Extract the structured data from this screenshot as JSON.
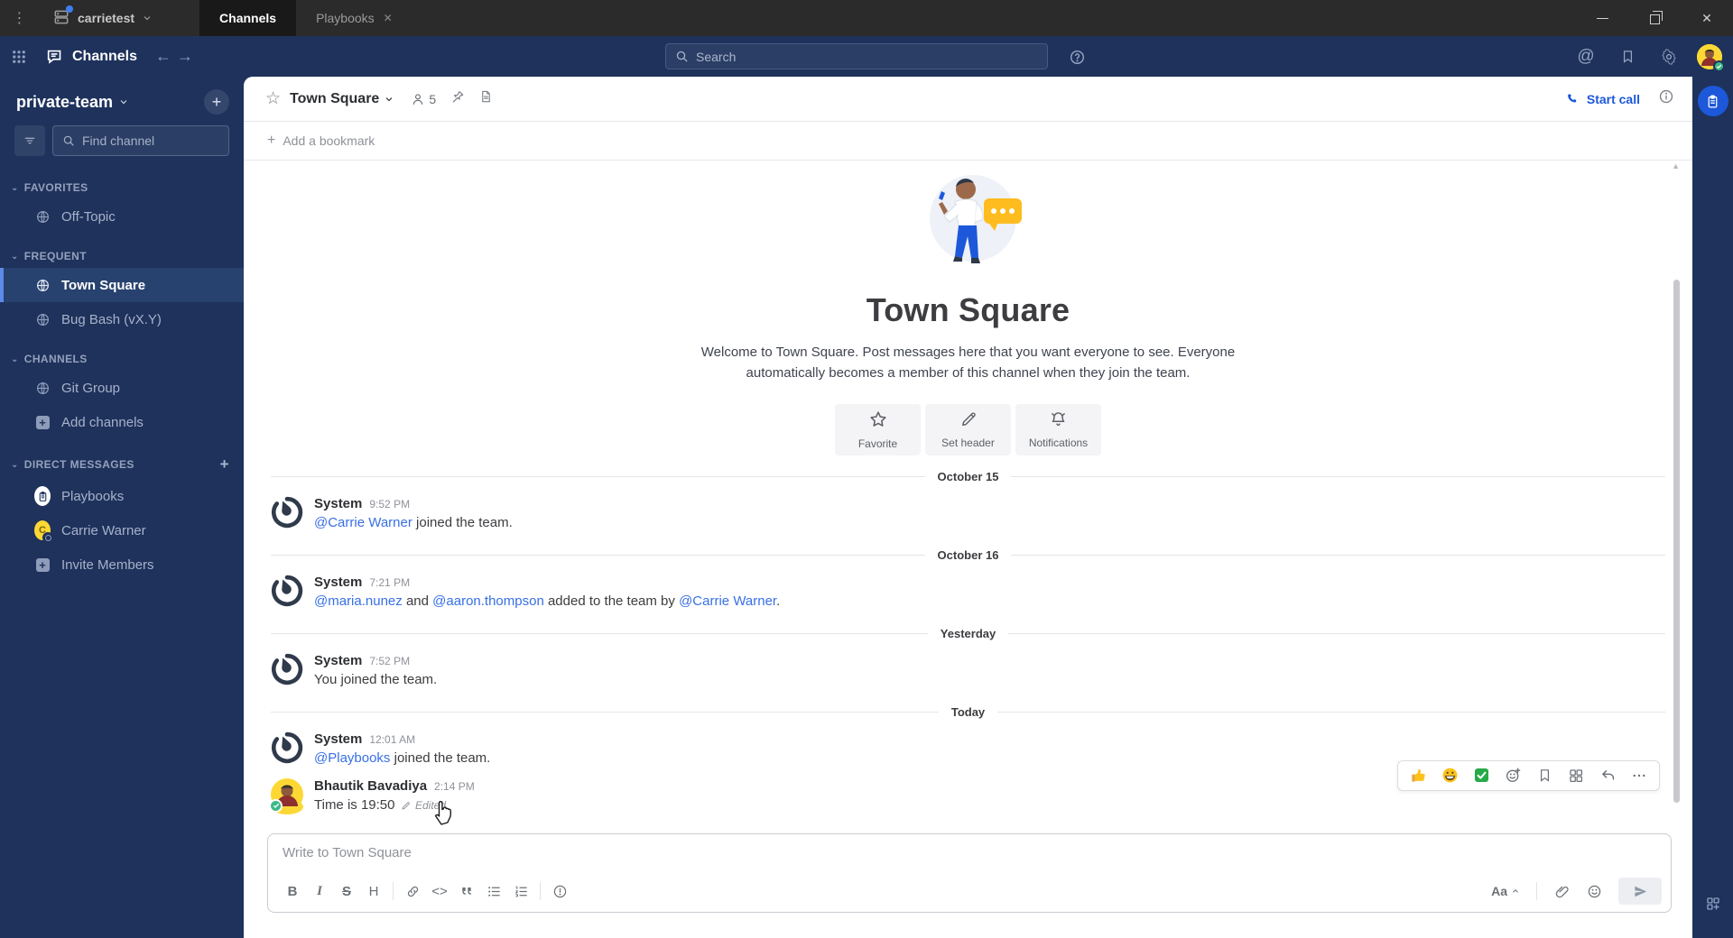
{
  "colors": {
    "accent": "#1c58d9",
    "link": "#386fe5",
    "sidebar_bg": "#1e325c",
    "titlebar_bg": "#2b2b2b"
  },
  "titlebar": {
    "server_name": "carrietest",
    "tabs": [
      {
        "label": "Channels",
        "active": true
      },
      {
        "label": "Playbooks",
        "active": false,
        "closable": true
      }
    ]
  },
  "global_header": {
    "product_label": "Channels",
    "search_placeholder": "Search"
  },
  "sidebar": {
    "team_name": "private-team",
    "find_placeholder": "Find channel",
    "sections": [
      {
        "label": "FAVORITES",
        "add_button": false,
        "items": [
          {
            "label": "Off-Topic",
            "icon": "globe-icon"
          }
        ]
      },
      {
        "label": "FREQUENT",
        "add_button": false,
        "items": [
          {
            "label": "Town Square",
            "icon": "globe-icon",
            "active": true
          },
          {
            "label": "Bug Bash (vX.Y)",
            "icon": "globe-icon"
          }
        ]
      },
      {
        "label": "CHANNELS",
        "add_button": false,
        "items": [
          {
            "label": "Git Group",
            "icon": "globe-icon"
          },
          {
            "label": "Add channels",
            "icon": "plus-box-icon"
          }
        ]
      },
      {
        "label": "DIRECT MESSAGES",
        "add_button": true,
        "items": [
          {
            "label": "Playbooks",
            "icon": "playbooks-avatar"
          },
          {
            "label": "Carrie Warner",
            "icon": "carrie-avatar",
            "avatar_letter": "C"
          },
          {
            "label": "Invite Members",
            "icon": "plus-box-icon"
          }
        ]
      }
    ]
  },
  "channel_header": {
    "name": "Town Square",
    "member_count": "5",
    "start_call_label": "Start call"
  },
  "bookmark_bar": {
    "label": "Add a bookmark"
  },
  "intro": {
    "title": "Town Square",
    "description": "Welcome to Town Square. Post messages here that you want everyone to see. Everyone automatically becomes a member of this channel when they join the team.",
    "buttons": [
      {
        "label": "Favorite",
        "icon": "star-icon"
      },
      {
        "label": "Set header",
        "icon": "pencil-icon"
      },
      {
        "label": "Notifications",
        "icon": "bell-icon"
      }
    ]
  },
  "feed": [
    {
      "type": "divider",
      "label": "October 15"
    },
    {
      "type": "post",
      "author": "System",
      "time": "9:52 PM",
      "avatar": "mattermost-logo",
      "parts": [
        {
          "link": true,
          "text": "@Carrie Warner"
        },
        {
          "text": " joined the team."
        }
      ]
    },
    {
      "type": "divider",
      "label": "October 16"
    },
    {
      "type": "post",
      "author": "System",
      "time": "7:21 PM",
      "avatar": "mattermost-logo",
      "parts": [
        {
          "link": true,
          "text": "@maria.nunez"
        },
        {
          "text": " and "
        },
        {
          "link": true,
          "text": "@aaron.thompson"
        },
        {
          "text": " added to the team by "
        },
        {
          "link": true,
          "text": "@Carrie Warner"
        },
        {
          "text": "."
        }
      ]
    },
    {
      "type": "divider",
      "label": "Yesterday"
    },
    {
      "type": "post",
      "author": "System",
      "time": "7:52 PM",
      "avatar": "mattermost-logo",
      "parts": [
        {
          "text": "You joined the team."
        }
      ]
    },
    {
      "type": "divider",
      "label": "Today"
    },
    {
      "type": "post",
      "author": "System",
      "time": "12:01 AM",
      "avatar": "mattermost-logo",
      "parts": [
        {
          "link": true,
          "text": "@Playbooks"
        },
        {
          "text": " joined the team."
        }
      ]
    },
    {
      "type": "post",
      "author": "Bhautik Bavadiya",
      "time": "2:14 PM",
      "avatar": "user-photo",
      "parts": [
        {
          "text": "Time is 19:50"
        }
      ],
      "edited_label": "Edited",
      "show_actions": true
    }
  ],
  "message_actions": {
    "reactions": [
      "thumbs-up-emoji",
      "grinning-emoji",
      "check-mark-emoji"
    ],
    "icons": [
      "add-reaction-icon",
      "save-message-icon",
      "message-apps-icon",
      "reply-icon",
      "more-actions-icon"
    ]
  },
  "composer": {
    "placeholder": "Write to Town Square",
    "formatting_label": "Aa",
    "format_buttons": [
      "bold",
      "italic",
      "strikethrough",
      "heading",
      "sep",
      "link",
      "code",
      "quote",
      "bulleted-list",
      "numbered-list",
      "sep",
      "priority"
    ],
    "heading_label": "H",
    "bold_label": "B",
    "italic_label": "I",
    "strike_label": "S",
    "code_label": "<>"
  }
}
